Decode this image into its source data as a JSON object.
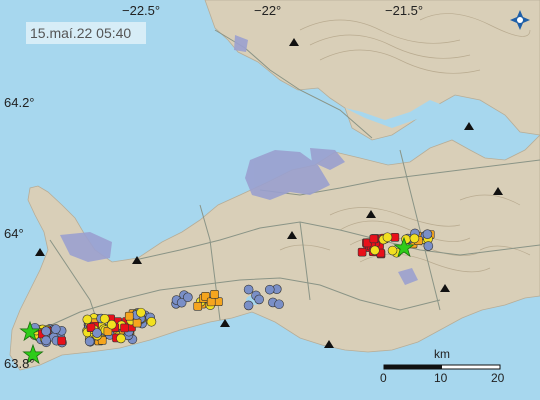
{
  "timestamp": "15.maí.22  05:40",
  "lon_ticks": [
    "−22.5°",
    "−22°",
    "−21.5°"
  ],
  "lat_ticks": [
    "64.2°",
    "64°",
    "63.8°"
  ],
  "scale_bar": {
    "unit": "km",
    "ticks": [
      "0",
      "10",
      "20"
    ]
  },
  "colors": {
    "sea": "#a7d7ee",
    "land": "#d9cfb8",
    "lava": "#9aa0cf",
    "quake_recent": "#e8101a",
    "quake_day": "#f5a51e",
    "quake_older": "#f2e020",
    "quake_week": "#7a8fc7",
    "star": "#2ecc1a"
  },
  "icons": {
    "logo": "imo-logo-icon",
    "peak": "triangle-peak-icon",
    "large_quake": "star-icon"
  }
}
